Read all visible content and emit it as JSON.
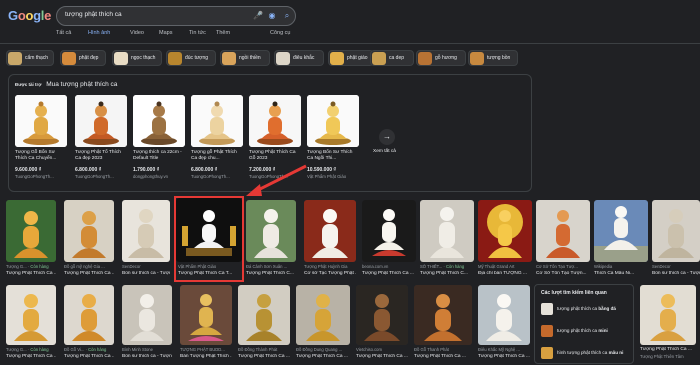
{
  "search": {
    "query": "tượng phật thích ca"
  },
  "tabs": [
    {
      "label": "Tất cả"
    },
    {
      "label": "Hình ảnh"
    },
    {
      "label": "Video"
    },
    {
      "label": "Maps"
    },
    {
      "label": "Tin tức"
    },
    {
      "label": "Thêm"
    },
    {
      "label": "Công cụ"
    }
  ],
  "chips": [
    {
      "label": "cẩm thạch"
    },
    {
      "label": "phật đẹp"
    },
    {
      "label": "ngọc thạch"
    },
    {
      "label": "đúc tượng"
    },
    {
      "label": "ngồi thiền"
    },
    {
      "label": "điêu khắc"
    },
    {
      "label": "phật giáo"
    },
    {
      "label": "ca dep"
    },
    {
      "label": "gỗ hương"
    },
    {
      "label": "tượng bồn"
    }
  ],
  "shopping": {
    "sponsored": "Được tài trợ",
    "title": "Mua tượng phật thích ca",
    "see_all": "Xem tất cả",
    "products": [
      {
        "name": "Tượng Gỗ Bổn Sư Thích Ca Chuyển...",
        "price": "9.600.000 ₫",
        "store": "TuongGoPhongTh..."
      },
      {
        "name": "Tượng Phật Tổ Thích Ca đẹp 2023",
        "price": "6.800.000 ₫",
        "store": "TuongGoPhongTh..."
      },
      {
        "name": "Tượng thích ca 22cm - Default Title",
        "price": "1.790.000 ₫",
        "store": "dongphongthuy.vn"
      },
      {
        "name": "Tượng gỗ Phật Thích Ca đẹp chu...",
        "price": "6.800.000 ₫",
        "store": "TuongGoPhongTh..."
      },
      {
        "name": "Tượng Phật Thích Ca Gỗ 2023",
        "price": "7.200.000 ₫",
        "store": "TuongGoPhongTh..."
      },
      {
        "name": "Tượng Bổn Sư Thích Ca Ngồi Thi...",
        "price": "10.590.000 ₫",
        "store": "Vật Phẩm Phật Giáo"
      }
    ]
  },
  "grid_row1": [
    {
      "src": "Tượng G...",
      "stock": "Còn hàng",
      "title": "Tượng Phật Thích Ca ..."
    },
    {
      "src": "Đồ gỗ mỹ nghệ Gia ...",
      "stock": "",
      "title": "Tượng Phật Thích Ca ..."
    },
    {
      "src": "SenDecor",
      "stock": "",
      "title": "Bổn sư thích ca - Tượng ..."
    },
    {
      "src": "Vật Phẩm Phật Giáo",
      "stock": "",
      "title": "Tượng Phật Thích Ca T..."
    },
    {
      "src": "Đá Cảnh Sơn Xuân ...",
      "stock": "",
      "title": "Tượng Phật Thích C..."
    },
    {
      "src": "Tượng Phật Huỳnh Gia",
      "stock": "",
      "title": "Cơ sở Tạc Tượng Phật ..."
    },
    {
      "src": "beona.com.vn",
      "stock": "",
      "title": "Tượng Phật Thích Ca ..."
    },
    {
      "src": "SỐ THIẾT...",
      "stock": "Còn hàng",
      "title": "Tượng Phật Thích C..."
    },
    {
      "src": "Mỹ Thuật Grand Art",
      "stock": "",
      "title": "Địa chỉ bán TƯỢNG ..."
    },
    {
      "src": "Cơ Sở Tôn Tạo Tượ...",
      "stock": "",
      "title": "Cơ Sở Tôn Tạo Tượn..."
    },
    {
      "src": "Wikipedia",
      "stock": "",
      "title": "Thích Ca Mâu Ni..."
    },
    {
      "src": "SenDecor",
      "stock": "",
      "title": "Bổn sư thích ca - Tượn..."
    }
  ],
  "grid_row2": [
    {
      "src": "Tượng G...",
      "stock": "Còn hàng",
      "title": "Tượng Phật Thích Ca ..."
    },
    {
      "src": "Đồ Gỗ Vi...",
      "stock": "Còn hàng",
      "title": "Tượng Phật Thích Ca ..."
    },
    {
      "src": "Bình Minh Stone",
      "stock": "",
      "title": "Bổn sư thích ca - Tượng ..."
    },
    {
      "src": "TƯỢNG PHẬT BUDD...",
      "stock": "",
      "title": "Bán Tượng Phật Thích ..."
    },
    {
      "src": "Đồ Đồng Thành Phát",
      "stock": "",
      "title": "Tượng Phật Thích Ca ..."
    },
    {
      "src": "Đồ Đồng Dung Quang ...",
      "stock": "",
      "title": "Tượng Phật Thích Ca ..."
    },
    {
      "src": "Vietchiso.com",
      "stock": "",
      "title": "Tượng Phật Thích Ca ..."
    },
    {
      "src": "Đồ Gỗ Thanh Phát",
      "stock": "",
      "title": "Tượng Phật Thích Ca ..."
    },
    {
      "src": "Điêu Khắc Mỹ Nghệ ...",
      "stock": "",
      "title": "Tượng Phật Thích Ca ..."
    },
    {
      "src": "Tượng Phật Thiên Tâm",
      "stock": "",
      "title": "Tượng Phật Thích Ca ..."
    }
  ],
  "related": {
    "title": "Các lượt tìm kiếm liên quan",
    "items": [
      {
        "prefix": "tượng phật thích ca ",
        "bold": "bằng đá"
      },
      {
        "prefix": "tượng phật thích ca ",
        "bold": "mini"
      },
      {
        "prefix": "hình tượng phật thích ca ",
        "bold": "mâu ni"
      }
    ]
  },
  "colors": {
    "background": "#202124",
    "accent": "#8ab4f8",
    "highlight": "#e53935",
    "stock": "#81c995"
  }
}
